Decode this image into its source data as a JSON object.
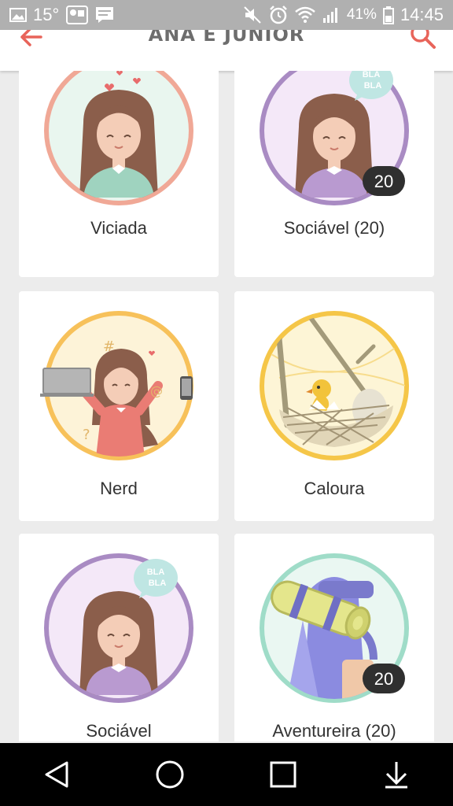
{
  "status_bar": {
    "temperature": "15°",
    "battery": "41%",
    "time": "14:45"
  },
  "header": {
    "title": "ANA E JUNIOR"
  },
  "badges": [
    {
      "label": "Viciada",
      "art": "viciada"
    },
    {
      "label": "Sociável (20)",
      "art": "sociavel",
      "count": "20",
      "bubble": [
        "BLA",
        "BLA"
      ]
    },
    {
      "label": "Nerd",
      "art": "nerd"
    },
    {
      "label": "Caloura",
      "art": "caloura"
    },
    {
      "label": "Sociável",
      "art": "sociavel",
      "bubble": [
        "BLA",
        "BLA"
      ]
    },
    {
      "label": "Aventureira (20)",
      "art": "aventureira",
      "count": "20"
    }
  ],
  "colors": {
    "accent": "#e8645a",
    "viciada_ring": "#f0a896",
    "sociavel_ring": "#a98bc3",
    "nerd_ring": "#f7c15a",
    "caloura_ring": "#f5c648",
    "aventureira_ring": "#9fdcc8"
  }
}
